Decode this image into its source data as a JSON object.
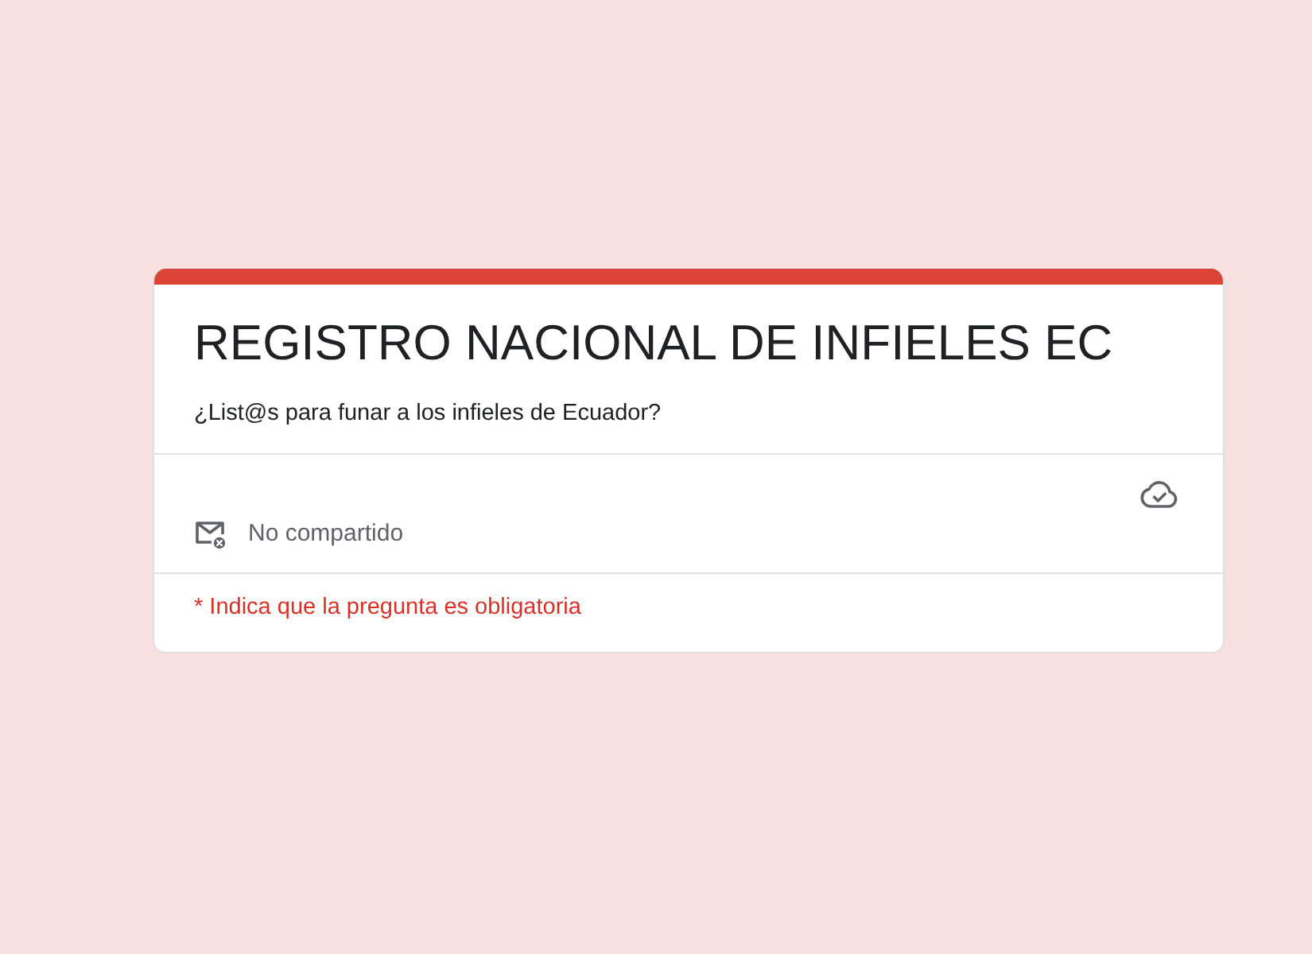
{
  "form": {
    "title": "REGISTRO NACIONAL DE INFIELES EC",
    "description": "¿List@s para funar a los infieles de Ecuador?",
    "sharing_status": "No compartido",
    "required_note": "* Indica que la pregunta es obligatoria"
  }
}
